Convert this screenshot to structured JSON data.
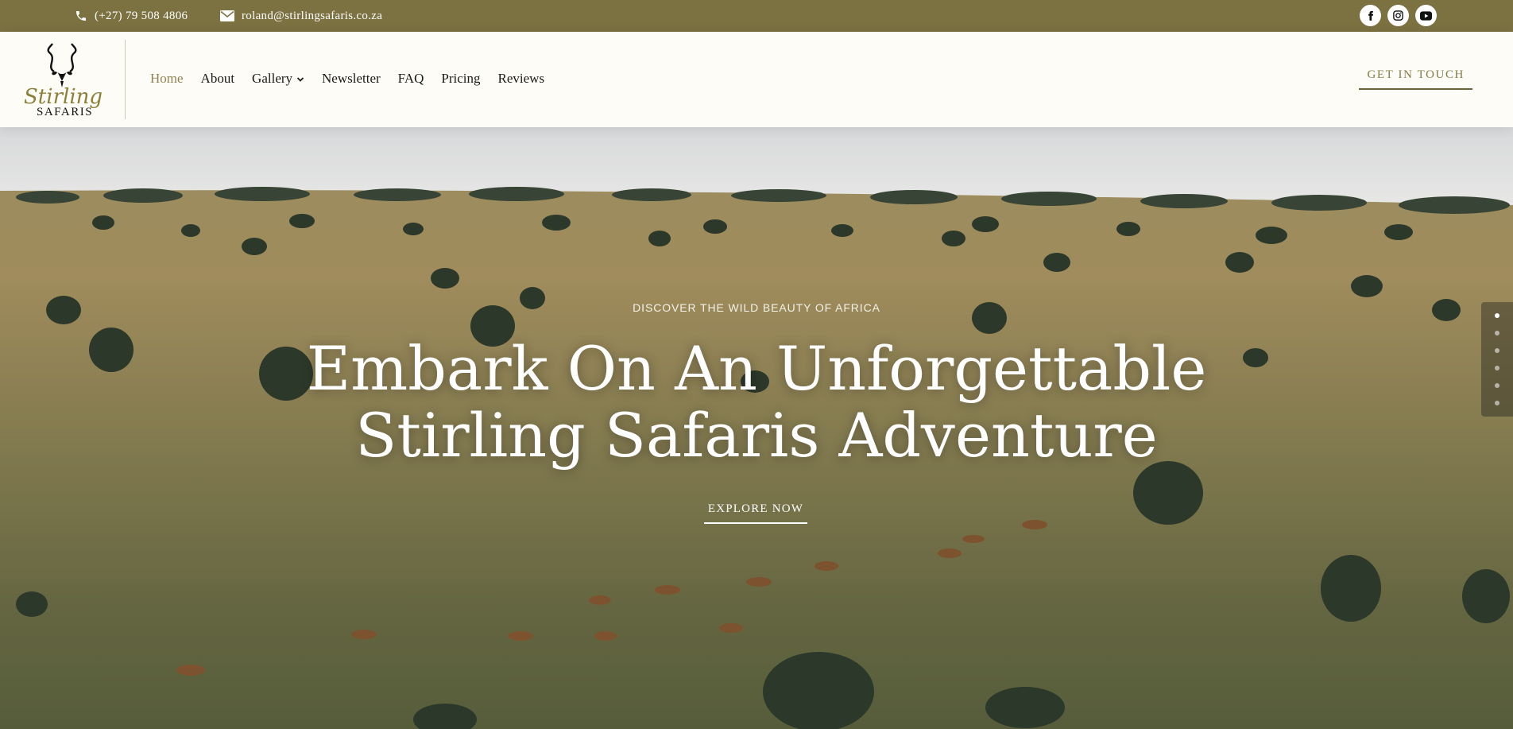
{
  "topbar": {
    "phone": "(+27) 79 508 4806",
    "email": "roland@stirlingsafaris.co.za",
    "socials": [
      {
        "name": "facebook-icon"
      },
      {
        "name": "instagram-icon"
      },
      {
        "name": "youtube-icon"
      }
    ]
  },
  "header": {
    "logo": {
      "script": "Stirling",
      "word": "SAFARIS"
    },
    "nav": [
      {
        "label": "Home",
        "active": true
      },
      {
        "label": "About"
      },
      {
        "label": "Gallery",
        "has_dropdown": true
      },
      {
        "label": "Newsletter"
      },
      {
        "label": "FAQ"
      },
      {
        "label": "Pricing"
      },
      {
        "label": "Reviews"
      }
    ],
    "cta_label": "GET IN TOUCH"
  },
  "hero": {
    "eyebrow": "DISCOVER THE WILD BEAUTY OF AFRICA",
    "headline_line1": "Embark On An Unforgettable",
    "headline_line2": "Stirling Safaris Adventure",
    "button_label": "EXPLORE NOW",
    "slide_count": 6,
    "active_slide": 1
  },
  "colors": {
    "topbar": "#7b7141",
    "nav_active": "#8e8453",
    "cta": "#857b45",
    "header_bg": "#fdfcf6"
  }
}
